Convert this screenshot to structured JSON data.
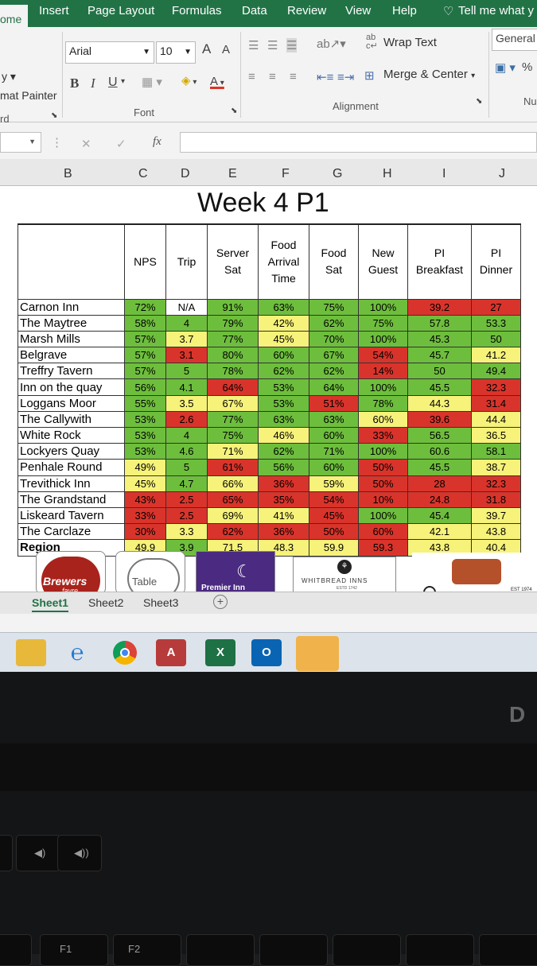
{
  "ribbon": {
    "tabs": [
      "ome",
      "Insert",
      "Page Layout",
      "Formulas",
      "Data",
      "Review",
      "View",
      "Help",
      "Tell me what y"
    ],
    "font_name": "Arial",
    "font_size": "10",
    "font_grow": "A",
    "font_shrink": "A",
    "bold": "B",
    "italic": "I",
    "underline": "U",
    "font_color_letter": "A",
    "wrap_text": "Wrap Text",
    "merge_center": "Merge & Center",
    "number_format": "General",
    "percent": "%",
    "clipboard_partial": "y",
    "format_painter_partial": "mat Painter",
    "clipboard_label_partial": "rd",
    "group_font": "Font",
    "group_alignment": "Alignment",
    "group_number_partial": "Nu"
  },
  "formula_bar": {
    "fx": "fx",
    "cancel": "✕",
    "enter": "✓",
    "value": ""
  },
  "columns": [
    "B",
    "C",
    "D",
    "E",
    "F",
    "G",
    "H",
    "I",
    "J"
  ],
  "sheet": {
    "title": "Week 4 P1",
    "headers": [
      [
        "NPS"
      ],
      [
        "Trip"
      ],
      [
        "Server",
        "Sat"
      ],
      [
        "Food",
        "Arrival",
        "Time"
      ],
      [
        "Food",
        "Sat"
      ],
      [
        "New",
        "Guest"
      ],
      [
        "PI",
        "Breakfast"
      ],
      [
        "PI",
        "Dinner"
      ]
    ],
    "rows": [
      {
        "name": "Carnon Inn",
        "values": [
          "72%",
          "N/A",
          "91%",
          "63%",
          "75%",
          "100%",
          "39.2",
          "27"
        ],
        "colors": [
          "g",
          "w",
          "g",
          "g",
          "g",
          "g",
          "r",
          "r"
        ]
      },
      {
        "name": "The Maytree",
        "values": [
          "58%",
          "4",
          "79%",
          "42%",
          "62%",
          "75%",
          "57.8",
          "53.3"
        ],
        "colors": [
          "g",
          "g",
          "g",
          "y",
          "g",
          "g",
          "g",
          "g"
        ]
      },
      {
        "name": "Marsh Mills",
        "values": [
          "57%",
          "3.7",
          "77%",
          "45%",
          "70%",
          "100%",
          "45.3",
          "50"
        ],
        "colors": [
          "g",
          "y",
          "g",
          "y",
          "g",
          "g",
          "g",
          "g"
        ]
      },
      {
        "name": "Belgrave",
        "values": [
          "57%",
          "3.1",
          "80%",
          "60%",
          "67%",
          "54%",
          "45.7",
          "41.2"
        ],
        "colors": [
          "g",
          "r",
          "g",
          "g",
          "g",
          "r",
          "g",
          "y"
        ]
      },
      {
        "name": "Treffry Tavern",
        "values": [
          "57%",
          "5",
          "78%",
          "62%",
          "62%",
          "14%",
          "50",
          "49.4"
        ],
        "colors": [
          "g",
          "g",
          "g",
          "g",
          "g",
          "r",
          "g",
          "g"
        ]
      },
      {
        "name": "Inn on the quay",
        "values": [
          "56%",
          "4.1",
          "64%",
          "53%",
          "64%",
          "100%",
          "45.5",
          "32.3"
        ],
        "colors": [
          "g",
          "g",
          "r",
          "g",
          "g",
          "g",
          "g",
          "r"
        ]
      },
      {
        "name": "Loggans Moor",
        "values": [
          "55%",
          "3.5",
          "67%",
          "53%",
          "51%",
          "78%",
          "44.3",
          "31.4"
        ],
        "colors": [
          "g",
          "y",
          "y",
          "g",
          "r",
          "g",
          "y",
          "r"
        ]
      },
      {
        "name": "The Callywith",
        "values": [
          "53%",
          "2.6",
          "77%",
          "63%",
          "63%",
          "60%",
          "39.6",
          "44.4"
        ],
        "colors": [
          "g",
          "r",
          "g",
          "g",
          "g",
          "y",
          "r",
          "y"
        ]
      },
      {
        "name": "White Rock",
        "values": [
          "53%",
          "4",
          "75%",
          "46%",
          "60%",
          "33%",
          "56.5",
          "36.5"
        ],
        "colors": [
          "g",
          "g",
          "g",
          "y",
          "g",
          "r",
          "g",
          "y"
        ]
      },
      {
        "name": "Lockyers Quay",
        "values": [
          "53%",
          "4.6",
          "71%",
          "62%",
          "71%",
          "100%",
          "60.6",
          "58.1"
        ],
        "colors": [
          "g",
          "g",
          "y",
          "g",
          "g",
          "g",
          "g",
          "g"
        ]
      },
      {
        "name": "Penhale Round",
        "values": [
          "49%",
          "5",
          "61%",
          "56%",
          "60%",
          "50%",
          "45.5",
          "38.7"
        ],
        "colors": [
          "y",
          "g",
          "r",
          "g",
          "g",
          "r",
          "g",
          "y"
        ]
      },
      {
        "name": "Trevithick Inn",
        "values": [
          "45%",
          "4.7",
          "66%",
          "36%",
          "59%",
          "50%",
          "28",
          "32.3"
        ],
        "colors": [
          "y",
          "g",
          "y",
          "r",
          "y",
          "r",
          "r",
          "r"
        ]
      },
      {
        "name": "The Grandstand",
        "values": [
          "43%",
          "2.5",
          "65%",
          "35%",
          "54%",
          "10%",
          "24.8",
          "31.8"
        ],
        "colors": [
          "r",
          "r",
          "r",
          "r",
          "r",
          "r",
          "r",
          "r"
        ]
      },
      {
        "name": "Liskeard Tavern",
        "values": [
          "33%",
          "2.5",
          "69%",
          "41%",
          "45%",
          "100%",
          "45.4",
          "39.7"
        ],
        "colors": [
          "r",
          "r",
          "y",
          "y",
          "r",
          "g",
          "g",
          "y"
        ]
      },
      {
        "name": "The Carclaze",
        "values": [
          "30%",
          "3.3",
          "62%",
          "36%",
          "50%",
          "60%",
          "42.1",
          "43.8"
        ],
        "colors": [
          "r",
          "y",
          "r",
          "r",
          "r",
          "r",
          "y",
          "y"
        ]
      },
      {
        "name": "Region",
        "values": [
          "49.9",
          "3.9",
          "71.5",
          "48.3",
          "59.9",
          "59.3",
          "43.8",
          "40.4"
        ],
        "colors": [
          "y",
          "g",
          "y",
          "y",
          "y",
          "r",
          "y",
          "y"
        ]
      }
    ]
  },
  "logos": {
    "brewers": "Brewers",
    "brewers_sub": "fayre",
    "table": "Table",
    "premier": "Premier Inn",
    "whitbread": "WHITBREAD INNS",
    "whitbread_est": "ESTD 1742",
    "beefeater_est": "EST 1974"
  },
  "sheet_tabs": [
    "Sheet1",
    "Sheet2",
    "Sheet3"
  ],
  "add_sheet": "+",
  "taskbar": {
    "access_letter": "A",
    "excel_letter": "X",
    "outlook_letter": "O"
  },
  "keyboard": {
    "f1": "F1",
    "f2": "F2",
    "brand_partial": "D"
  }
}
